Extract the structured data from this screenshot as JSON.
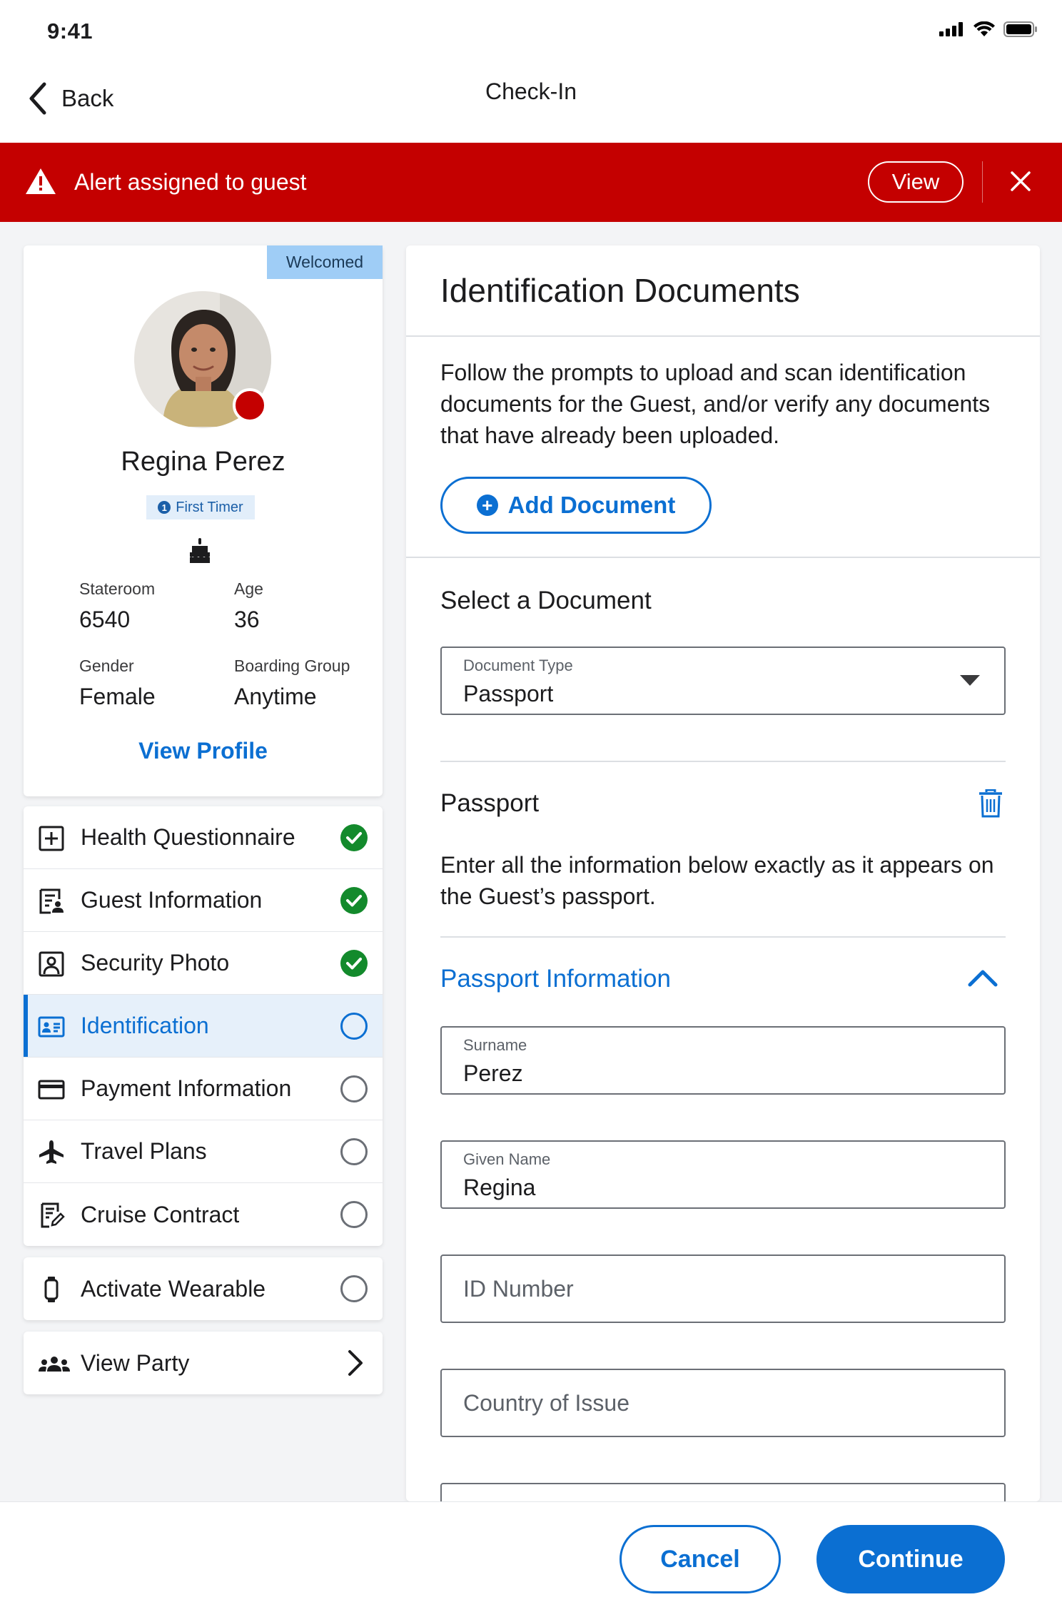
{
  "status_bar": {
    "time": "9:41"
  },
  "nav": {
    "back_label": "Back",
    "title": "Check-In"
  },
  "alert": {
    "message": "Alert assigned to guest",
    "view_label": "View"
  },
  "profile": {
    "badge": "Welcomed",
    "name": "Regina Perez",
    "tag": "First Timer",
    "tag_number": "1",
    "stats": [
      {
        "label": "Stateroom",
        "value": "6540"
      },
      {
        "label": "Age",
        "value": "36"
      },
      {
        "label": "Gender",
        "value": "Female"
      },
      {
        "label": "Boarding Group",
        "value": "Anytime"
      }
    ],
    "view_profile": "View Profile"
  },
  "checklist": [
    {
      "label": "Health Questionnaire",
      "icon": "plus-square-icon",
      "status": "complete"
    },
    {
      "label": "Guest Information",
      "icon": "guest-form-icon",
      "status": "complete"
    },
    {
      "label": "Security Photo",
      "icon": "portrait-icon",
      "status": "complete"
    },
    {
      "label": "Identification",
      "icon": "id-card-icon",
      "status": "active"
    },
    {
      "label": "Payment Information",
      "icon": "credit-card-icon",
      "status": "pending"
    },
    {
      "label": "Travel Plans",
      "icon": "airplane-icon",
      "status": "pending"
    },
    {
      "label": "Cruise Contract",
      "icon": "contract-sign-icon",
      "status": "pending"
    }
  ],
  "wearable": {
    "label": "Activate Wearable",
    "icon": "wearable-icon",
    "status": "pending"
  },
  "party": {
    "label": "View Party",
    "icon": "group-icon"
  },
  "panel": {
    "title": "Identification Documents",
    "intro": "Follow the prompts to upload and scan identification documents for the Guest, and/or verify any documents that have already been uploaded.",
    "add_document": "Add Document",
    "select_heading": "Select a Document",
    "document_type": {
      "label": "Document Type",
      "value": "Passport"
    },
    "passport_heading": "Passport",
    "passport_desc": "Enter all the information below exactly as it appears on the Guest’s passport.",
    "passport_info_heading": "Passport Information",
    "surname": {
      "label": "Surname",
      "value": "Perez"
    },
    "given_name": {
      "label": "Given Name",
      "value": "Regina"
    },
    "id_number": {
      "placeholder": "ID Number"
    },
    "country_of_issue": {
      "placeholder": "Country of Issue"
    }
  },
  "footer": {
    "cancel": "Cancel",
    "continue": "Continue"
  },
  "colors": {
    "accent": "#0b6fd2",
    "alert": "#c40000",
    "success": "#138a2c",
    "badge": "#9fcdf6"
  }
}
